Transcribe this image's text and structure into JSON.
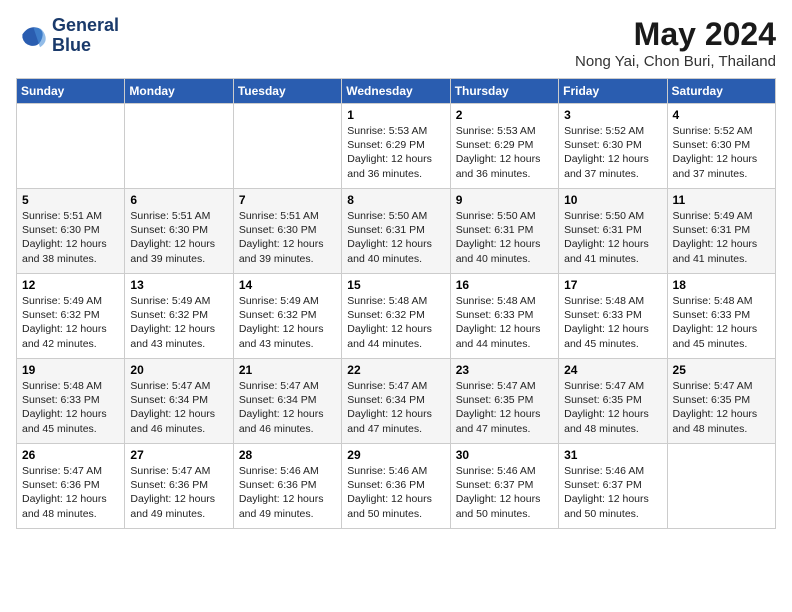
{
  "header": {
    "logo_line1": "General",
    "logo_line2": "Blue",
    "month_title": "May 2024",
    "location": "Nong Yai, Chon Buri, Thailand"
  },
  "weekdays": [
    "Sunday",
    "Monday",
    "Tuesday",
    "Wednesday",
    "Thursday",
    "Friday",
    "Saturday"
  ],
  "weeks": [
    [
      {
        "day": "",
        "info": ""
      },
      {
        "day": "",
        "info": ""
      },
      {
        "day": "",
        "info": ""
      },
      {
        "day": "1",
        "info": "Sunrise: 5:53 AM\nSunset: 6:29 PM\nDaylight: 12 hours\nand 36 minutes."
      },
      {
        "day": "2",
        "info": "Sunrise: 5:53 AM\nSunset: 6:29 PM\nDaylight: 12 hours\nand 36 minutes."
      },
      {
        "day": "3",
        "info": "Sunrise: 5:52 AM\nSunset: 6:30 PM\nDaylight: 12 hours\nand 37 minutes."
      },
      {
        "day": "4",
        "info": "Sunrise: 5:52 AM\nSunset: 6:30 PM\nDaylight: 12 hours\nand 37 minutes."
      }
    ],
    [
      {
        "day": "5",
        "info": "Sunrise: 5:51 AM\nSunset: 6:30 PM\nDaylight: 12 hours\nand 38 minutes."
      },
      {
        "day": "6",
        "info": "Sunrise: 5:51 AM\nSunset: 6:30 PM\nDaylight: 12 hours\nand 39 minutes."
      },
      {
        "day": "7",
        "info": "Sunrise: 5:51 AM\nSunset: 6:30 PM\nDaylight: 12 hours\nand 39 minutes."
      },
      {
        "day": "8",
        "info": "Sunrise: 5:50 AM\nSunset: 6:31 PM\nDaylight: 12 hours\nand 40 minutes."
      },
      {
        "day": "9",
        "info": "Sunrise: 5:50 AM\nSunset: 6:31 PM\nDaylight: 12 hours\nand 40 minutes."
      },
      {
        "day": "10",
        "info": "Sunrise: 5:50 AM\nSunset: 6:31 PM\nDaylight: 12 hours\nand 41 minutes."
      },
      {
        "day": "11",
        "info": "Sunrise: 5:49 AM\nSunset: 6:31 PM\nDaylight: 12 hours\nand 41 minutes."
      }
    ],
    [
      {
        "day": "12",
        "info": "Sunrise: 5:49 AM\nSunset: 6:32 PM\nDaylight: 12 hours\nand 42 minutes."
      },
      {
        "day": "13",
        "info": "Sunrise: 5:49 AM\nSunset: 6:32 PM\nDaylight: 12 hours\nand 43 minutes."
      },
      {
        "day": "14",
        "info": "Sunrise: 5:49 AM\nSunset: 6:32 PM\nDaylight: 12 hours\nand 43 minutes."
      },
      {
        "day": "15",
        "info": "Sunrise: 5:48 AM\nSunset: 6:32 PM\nDaylight: 12 hours\nand 44 minutes."
      },
      {
        "day": "16",
        "info": "Sunrise: 5:48 AM\nSunset: 6:33 PM\nDaylight: 12 hours\nand 44 minutes."
      },
      {
        "day": "17",
        "info": "Sunrise: 5:48 AM\nSunset: 6:33 PM\nDaylight: 12 hours\nand 45 minutes."
      },
      {
        "day": "18",
        "info": "Sunrise: 5:48 AM\nSunset: 6:33 PM\nDaylight: 12 hours\nand 45 minutes."
      }
    ],
    [
      {
        "day": "19",
        "info": "Sunrise: 5:48 AM\nSunset: 6:33 PM\nDaylight: 12 hours\nand 45 minutes."
      },
      {
        "day": "20",
        "info": "Sunrise: 5:47 AM\nSunset: 6:34 PM\nDaylight: 12 hours\nand 46 minutes."
      },
      {
        "day": "21",
        "info": "Sunrise: 5:47 AM\nSunset: 6:34 PM\nDaylight: 12 hours\nand 46 minutes."
      },
      {
        "day": "22",
        "info": "Sunrise: 5:47 AM\nSunset: 6:34 PM\nDaylight: 12 hours\nand 47 minutes."
      },
      {
        "day": "23",
        "info": "Sunrise: 5:47 AM\nSunset: 6:35 PM\nDaylight: 12 hours\nand 47 minutes."
      },
      {
        "day": "24",
        "info": "Sunrise: 5:47 AM\nSunset: 6:35 PM\nDaylight: 12 hours\nand 48 minutes."
      },
      {
        "day": "25",
        "info": "Sunrise: 5:47 AM\nSunset: 6:35 PM\nDaylight: 12 hours\nand 48 minutes."
      }
    ],
    [
      {
        "day": "26",
        "info": "Sunrise: 5:47 AM\nSunset: 6:36 PM\nDaylight: 12 hours\nand 48 minutes."
      },
      {
        "day": "27",
        "info": "Sunrise: 5:47 AM\nSunset: 6:36 PM\nDaylight: 12 hours\nand 49 minutes."
      },
      {
        "day": "28",
        "info": "Sunrise: 5:46 AM\nSunset: 6:36 PM\nDaylight: 12 hours\nand 49 minutes."
      },
      {
        "day": "29",
        "info": "Sunrise: 5:46 AM\nSunset: 6:36 PM\nDaylight: 12 hours\nand 50 minutes."
      },
      {
        "day": "30",
        "info": "Sunrise: 5:46 AM\nSunset: 6:37 PM\nDaylight: 12 hours\nand 50 minutes."
      },
      {
        "day": "31",
        "info": "Sunrise: 5:46 AM\nSunset: 6:37 PM\nDaylight: 12 hours\nand 50 minutes."
      },
      {
        "day": "",
        "info": ""
      }
    ]
  ]
}
